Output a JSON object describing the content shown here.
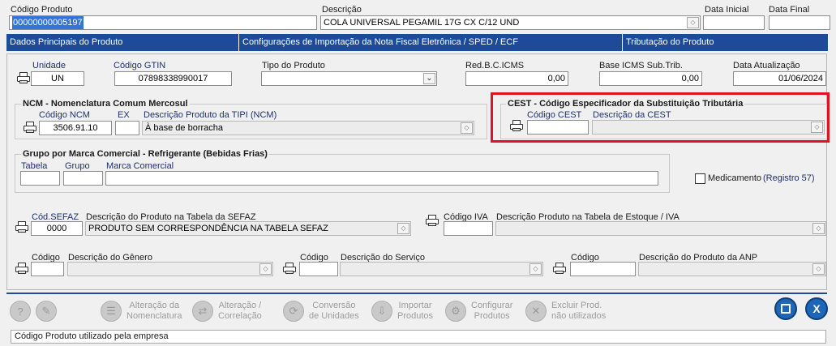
{
  "header": {
    "codigo_produto_label": "Código Produto",
    "codigo_produto_value": "00000000005197",
    "descricao_label": "Descrição",
    "descricao_value": "COLA UNIVERSAL PEGAMIL 17G CX C/12 UND",
    "data_inicial_label": "Data Inicial",
    "data_inicial_value": "",
    "data_final_label": "Data Final",
    "data_final_value": ""
  },
  "tabs": [
    {
      "label": "Dados Principais do Produto",
      "active": true
    },
    {
      "label": "Configurações de Importação da Nota Fiscal Eletrônica / SPED / ECF",
      "active": false
    },
    {
      "label": "Tributação do Produto",
      "active": false
    }
  ],
  "main": {
    "unidade_label": "Unidade",
    "unidade_value": "UN",
    "gtin_label": "Código GTIN",
    "gtin_value": "07898338990017",
    "tipo_label": "Tipo do Produto",
    "tipo_value": "",
    "redbc_label": "Red.B.C.ICMS",
    "redbc_value": "0,00",
    "baseicms_label": "Base ICMS Sub.Trib.",
    "baseicms_value": "0,00",
    "dataatual_label": "Data Atualização",
    "dataatual_value": "01/06/2024"
  },
  "ncm": {
    "title": "NCM - Nomenclatura Comum Mercosul",
    "codigo_label": "Código NCM",
    "codigo_value": "3506.91.10",
    "ex_label": "EX",
    "ex_value": "",
    "desc_label": "Descrição Produto da TIPI (NCM)",
    "desc_value": "À base de borracha"
  },
  "cest": {
    "title": "CEST - Código Especificador da Substituição Tributária",
    "codigo_label": "Código CEST",
    "codigo_value": "",
    "desc_label": "Descrição da CEST",
    "desc_value": ""
  },
  "grupo": {
    "title": "Grupo por Marca Comercial - Refrigerante (Bebidas Frias)",
    "tabela_label": "Tabela",
    "tabela_value": "",
    "grupo_label": "Grupo",
    "grupo_value": "",
    "marca_label": "Marca Comercial",
    "marca_value": ""
  },
  "medicamento": {
    "label": "Medicamento",
    "registro": "(Registro  57)",
    "checked": false
  },
  "sefaz": {
    "codigo_label": "Cód.SEFAZ",
    "codigo_value": "0000",
    "desc_label": "Descrição do Produto na Tabela da SEFAZ",
    "desc_value": "PRODUTO SEM CORRESPONDÊNCIA NA TABELA SEFAZ"
  },
  "iva": {
    "codigo_label": "Código IVA",
    "codigo_value": "",
    "desc_label": "Descrição Produto na Tabela de Estoque / IVA",
    "desc_value": ""
  },
  "genero": {
    "codigo_label": "Código",
    "codigo_value": "",
    "desc_label": "Descrição do Gênero",
    "desc_value": ""
  },
  "servico": {
    "codigo_label": "Código",
    "codigo_value": "",
    "desc_label": "Descrição do Serviço",
    "desc_value": ""
  },
  "anp": {
    "codigo_label": "Código",
    "codigo_value": "",
    "desc_label": "Descrição do Produto da ANP",
    "desc_value": ""
  },
  "toolbar": {
    "alteracao_nomenclatura_1": "Alteração da",
    "alteracao_nomenclatura_2": "Nomenclatura",
    "alteracao_correlacao_1": "Alteração /",
    "alteracao_correlacao_2": "Correlação",
    "conversao_1": "Conversão",
    "conversao_2": "de Unidades",
    "importar_1": "Importar",
    "importar_2": "Produtos",
    "configurar_1": "Configurar",
    "configurar_2": "Produtos",
    "excluir_1": "Excluir Prod.",
    "excluir_2": "não utilizados",
    "save_glyph": "💾",
    "close_glyph": "X"
  },
  "status": {
    "text": "Código Produto utilizado pela empresa"
  },
  "colors": {
    "tab_bg": "#1d4b99",
    "highlight_border": "#e0141e",
    "label_blue": "#1e2f6e"
  }
}
